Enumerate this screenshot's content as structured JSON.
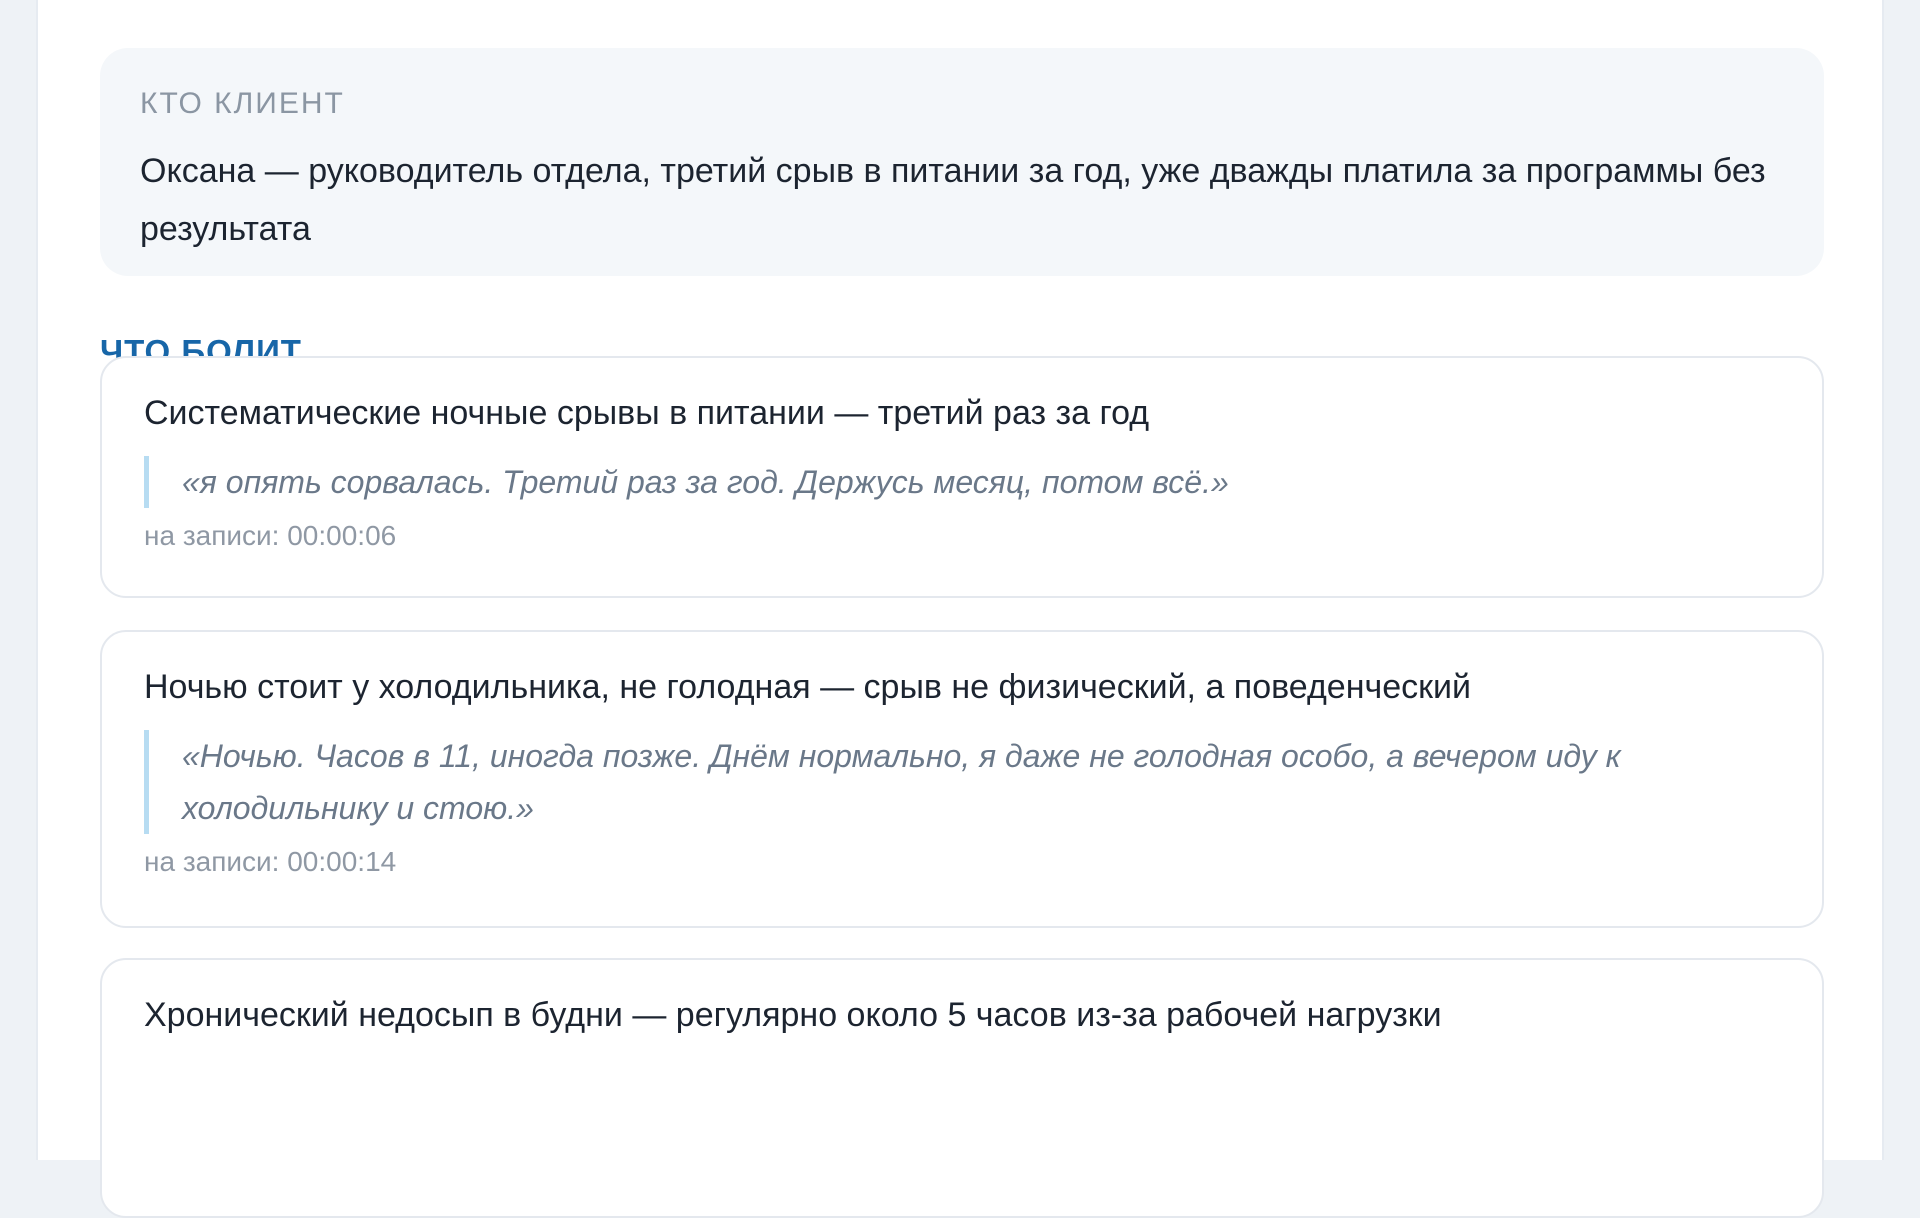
{
  "client": {
    "label": "КТО КЛИЕНТ",
    "text": "Оксана — руководитель отдела, третий срыв в питании за год, уже дважды платила за программы без результата"
  },
  "pain_section": {
    "title": "ЧТО БОЛИТ"
  },
  "cards": [
    {
      "title": "Систематические ночные срывы в питании — третий раз за год",
      "quote": "«я опять сорвалась. Третий раз за год. Держусь месяц, потом всё.»",
      "timestamp": "на записи: 00:00:06"
    },
    {
      "title": "Ночью стоит у холодильника, не голодная — срыв не физический, а поведенческий",
      "quote": "«Ночью. Часов в 11, иногда позже. Днём нормально, я даже не голодная особо, а вечером иду к холодильнику и стою.»",
      "timestamp": "на записи: 00:00:14"
    },
    {
      "title": "Хронический недосып в будни — регулярно около 5 часов из-за рабочей нагрузки"
    }
  ],
  "colors": {
    "background": "#eef2f6",
    "accent": "#1766a8",
    "quote_border": "#b7dcf2"
  }
}
